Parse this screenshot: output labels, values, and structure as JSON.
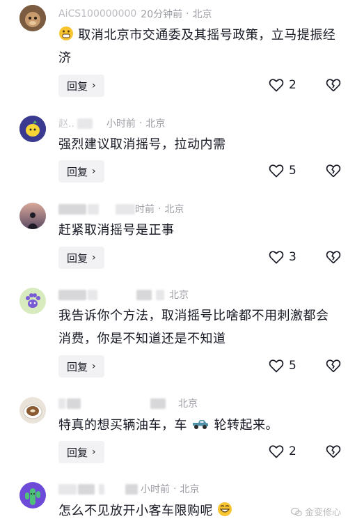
{
  "comments": [
    {
      "user": "AiCS100000000",
      "time": "20分钟前",
      "location": "北京",
      "text_parts": [
        "取消北京市交通委及其摇号政策，立马提振经济"
      ],
      "reply_label": "回复",
      "likes": "2",
      "avatar_icon": "monkey-icon"
    },
    {
      "user": "赵..",
      "time": "小时前",
      "location": "北京",
      "text_parts": [
        "强烈建议取消摇号，拉动内需"
      ],
      "reply_label": "回复",
      "likes": "5",
      "avatar_icon": "lemon-icon"
    },
    {
      "time": "时前",
      "location": "北京",
      "text_parts": [
        "赶紧取消摇号是正事"
      ],
      "reply_label": "回复",
      "likes": "3",
      "avatar_icon": "silhouette-icon"
    },
    {
      "location": "北京",
      "text_parts": [
        "我告诉你个方法，取消摇号比啥都不用刺激都会消费，你是不知道还是不知道"
      ],
      "reply_label": "回复",
      "likes": "5",
      "avatar_icon": "paw-icon"
    },
    {
      "location": "北京",
      "text_parts": [
        "特真的想买辆油车，车",
        "轮转起来。"
      ],
      "reply_label": "回复",
      "likes": "2",
      "avatar_icon": "coffee-icon"
    },
    {
      "time": "小时前",
      "location": "北京",
      "text_parts": [
        "怎么不见放开小客车限购呢"
      ],
      "avatar_icon": "cactus-icon"
    }
  ],
  "watermark": "金变修心",
  "colors": {
    "meta": "#9a9ba3",
    "text": "#161823",
    "reply_bg": "#f2f2f4"
  }
}
